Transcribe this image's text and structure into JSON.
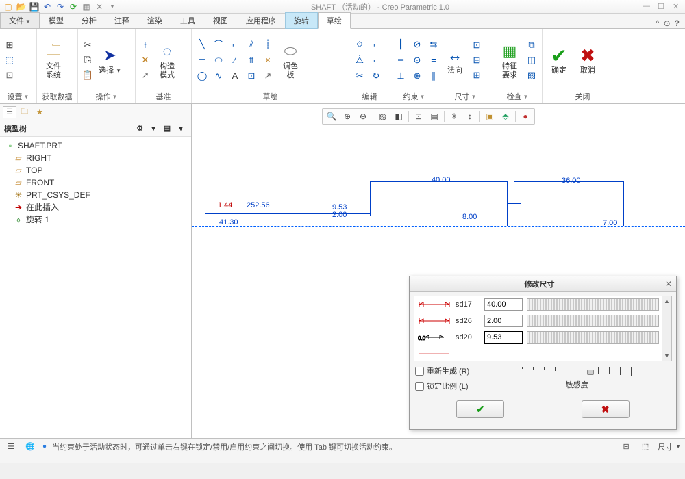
{
  "app": {
    "title": "SHAFT （活动的） - Creo Parametric 1.0"
  },
  "tabs": {
    "file": "文件",
    "items": [
      "模型",
      "分析",
      "注释",
      "渲染",
      "工具",
      "视图",
      "应用程序"
    ],
    "context": [
      "旋转",
      "草绘"
    ],
    "active": "草绘"
  },
  "ribbon": {
    "g_settings": {
      "label": "设置",
      "btn_grid": "",
      "btn_ref": "",
      "btn_sys": ""
    },
    "g_getdata": {
      "label": "获取数据",
      "file_system": "文件\n系统"
    },
    "g_ops": {
      "label": "操作",
      "select": "选择"
    },
    "g_datum": {
      "label": "基准",
      "construct": "构造\n模式"
    },
    "g_sketch": {
      "label": "草绘",
      "palette": "调色\n板"
    },
    "g_edit": {
      "label": "编辑"
    },
    "g_constrain": {
      "label": "约束"
    },
    "g_dim": {
      "label": "尺寸",
      "normal": "法向",
      "feature": "特征\n要求"
    },
    "g_inspect": {
      "label": "检查",
      "ok": "确定",
      "cancel": "取消"
    },
    "g_close": {
      "label": "关闭"
    }
  },
  "sidebar": {
    "title": "模型树",
    "root": "SHAFT.PRT",
    "nodes": [
      {
        "icon": "▱",
        "label": "RIGHT",
        "color": "#c08020"
      },
      {
        "icon": "▱",
        "label": "TOP",
        "color": "#c08020"
      },
      {
        "icon": "▱",
        "label": "FRONT",
        "color": "#c08020"
      },
      {
        "icon": "✳",
        "label": "PRT_CSYS_DEF",
        "color": "#806000"
      },
      {
        "icon": "➔",
        "label": "在此插入",
        "color": "#c00000"
      },
      {
        "icon": "⬨",
        "label": "旋转 1",
        "color": "#208020"
      }
    ]
  },
  "sketch_dims": {
    "d40": "40.00",
    "d36": "36.00",
    "d8": "8.00",
    "d7": "7.00",
    "d252": "252.56",
    "d144": "1.44",
    "d413": "41.30",
    "d953l": "9.53",
    "d953r": "2.00"
  },
  "dialog": {
    "title": "修改尺寸",
    "rows": [
      {
        "name": "sd17",
        "value": "40.00",
        "glyph": "h-red"
      },
      {
        "name": "sd26",
        "value": "2.00",
        "glyph": "h-red"
      },
      {
        "name": "sd20",
        "value": "9.53",
        "glyph": "h-blk",
        "active": true
      }
    ],
    "regenerate": "重新生成 (R)",
    "lock": "锁定比例 (L)",
    "sensitivity": "敏感度"
  },
  "status": {
    "msg": "当约束处于活动状态时，可通过单击右键在锁定/禁用/启用约束之间切换。使用 Tab 键可切换活动约束。",
    "filter": "尺寸"
  }
}
